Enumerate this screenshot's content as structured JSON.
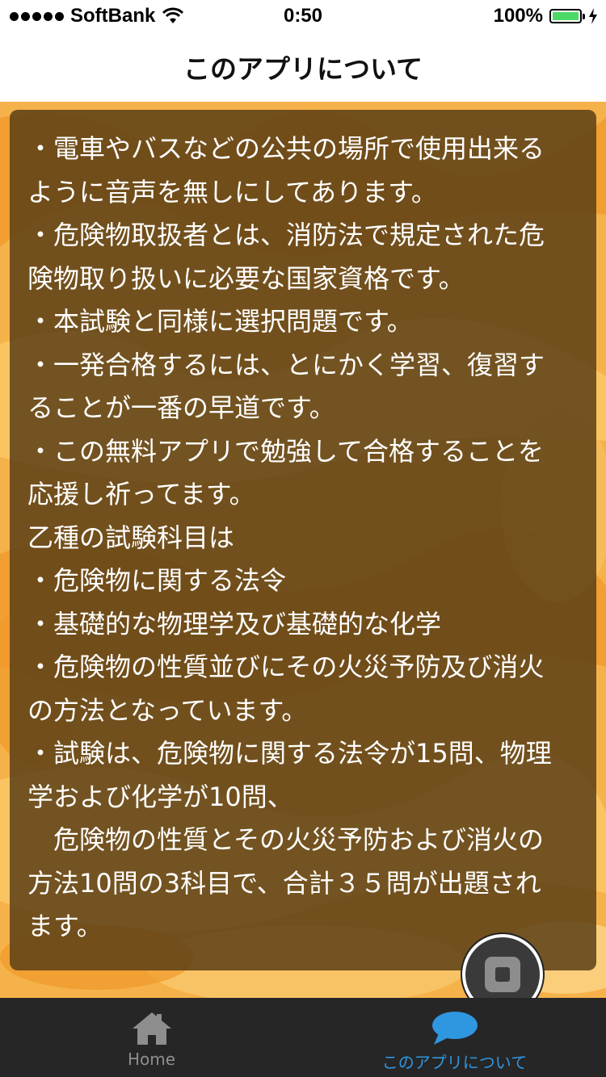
{
  "status_bar": {
    "carrier": "SoftBank",
    "time": "0:50",
    "battery": "100%",
    "signal_icon": "signal-dots-icon",
    "wifi_icon": "wifi-icon",
    "charge_icon": "charging-bolt-icon"
  },
  "nav": {
    "title": "このアプリについて"
  },
  "content": {
    "lines": [
      "・電車やバスなどの公共の場所で使用出来る",
      "ように音声を無しにしてあります。",
      "・危険物取扱者とは、消防法で規定された危",
      "険物取り扱いに必要な国家資格です。",
      "・本試験と同様に選択問題です。",
      "・一発合格するには、とにかく学習、復習す",
      "ることが一番の早道です。",
      "・この無料アプリで勉強して合格することを",
      "応援し祈ってます。",
      "乙種の試験科目は",
      "・危険物に関する法令",
      "・基礎的な物理学及び基礎的な化学",
      "・危険物の性質並びにその火災予防及び消火",
      "の方法となっています。",
      "・試験は、危険物に関する法令が15問、物理",
      "学および化学が10問、",
      "　危険物の性質とその火災予防および消火の",
      "方法10問の3科目で、合計３５問が出題され",
      "ます。"
    ]
  },
  "float_button": {
    "icon": "stop-icon"
  },
  "tab_bar": {
    "tabs": [
      {
        "label": "Home",
        "icon": "home-icon",
        "active": false
      },
      {
        "label": "このアプリについて",
        "icon": "speech-bubble-icon",
        "active": true
      }
    ]
  },
  "colors": {
    "panel_bg": "#5c4016",
    "background_orange": "#f6b24a",
    "tab_bar_bg": "#262626",
    "active_tab": "#2f96e0",
    "inactive_tab": "#8e8e8e"
  }
}
